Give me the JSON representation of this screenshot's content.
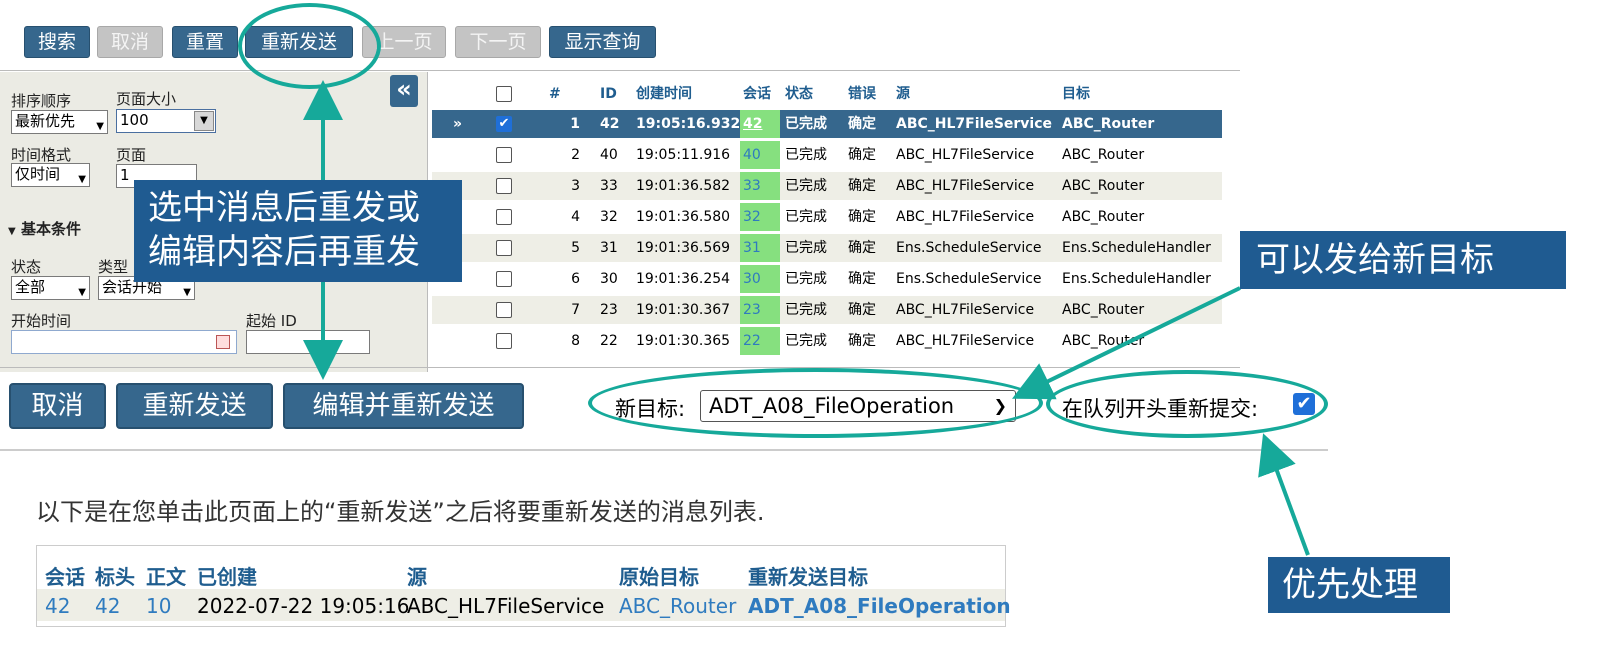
{
  "toolbar": {
    "search": "搜索",
    "cancel": "取消",
    "reset": "重置",
    "resend": "重新发送",
    "prev": "上一页",
    "next": "下一页",
    "show_query": "显示查询"
  },
  "filter": {
    "sort_label": "排序顺序",
    "sort_value": "最新优先",
    "pagesize_label": "页面大小",
    "pagesize_value": "100",
    "timeformat_label": "时间格式",
    "timeformat_value": "仅时间",
    "page_label": "页面",
    "page_value": "1",
    "section_title": "基本条件",
    "status_label": "状态",
    "status_value": "全部",
    "type_label": "类型",
    "type_value": "会话开始",
    "start_time_label": "开始时间",
    "start_id_label": "起始 ID",
    "collapse_glyph": "«"
  },
  "table": {
    "headers": {
      "num": "#",
      "id": "ID",
      "time": "创建时间",
      "session": "会话",
      "status": "状态",
      "error": "错误",
      "source": "源",
      "target": "目标"
    },
    "selected_marker": "»",
    "rows": [
      {
        "num": "1",
        "id": "42",
        "time": "19:05:16.932",
        "session": "42",
        "status": "已完成",
        "error": "确定",
        "source": "ABC_HL7FileService",
        "target": "ABC_Router"
      },
      {
        "num": "2",
        "id": "40",
        "time": "19:05:11.916",
        "session": "40",
        "status": "已完成",
        "error": "确定",
        "source": "ABC_HL7FileService",
        "target": "ABC_Router"
      },
      {
        "num": "3",
        "id": "33",
        "time": "19:01:36.582",
        "session": "33",
        "status": "已完成",
        "error": "确定",
        "source": "ABC_HL7FileService",
        "target": "ABC_Router"
      },
      {
        "num": "4",
        "id": "32",
        "time": "19:01:36.580",
        "session": "32",
        "status": "已完成",
        "error": "确定",
        "source": "ABC_HL7FileService",
        "target": "ABC_Router"
      },
      {
        "num": "5",
        "id": "31",
        "time": "19:01:36.569",
        "session": "31",
        "status": "已完成",
        "error": "确定",
        "source": "Ens.ScheduleService",
        "target": "Ens.ScheduleHandler"
      },
      {
        "num": "6",
        "id": "30",
        "time": "19:01:36.254",
        "session": "30",
        "status": "已完成",
        "error": "确定",
        "source": "Ens.ScheduleService",
        "target": "Ens.ScheduleHandler"
      },
      {
        "num": "7",
        "id": "23",
        "time": "19:01:30.367",
        "session": "23",
        "status": "已完成",
        "error": "确定",
        "source": "ABC_HL7FileService",
        "target": "ABC_Router"
      },
      {
        "num": "8",
        "id": "22",
        "time": "19:01:30.365",
        "session": "22",
        "status": "已完成",
        "error": "确定",
        "source": "ABC_HL7FileService",
        "target": "ABC_Router"
      }
    ]
  },
  "actions": {
    "cancel": "取消",
    "resend": "重新发送",
    "edit_resend": "编辑并重新发送",
    "new_target_label": "新目标:",
    "new_target_value": "ADT_A08_FileOperation",
    "head_of_queue_label": "在队列开头重新提交:"
  },
  "callouts": {
    "resend_line1": "选中消息后重发或",
    "resend_line2": "编辑内容后再重发",
    "new_target": "可以发给新目标",
    "priority": "优先处理"
  },
  "list": {
    "intro": "以下是在您单击此页面上的“重新发送”之后将要重新发送的消息列表.",
    "headers": {
      "session": "会话",
      "header": "标头",
      "body": "正文",
      "created": "已创建",
      "source": "源",
      "orig_target": "原始目标",
      "resend_target": "重新发送目标"
    },
    "row": {
      "session": "42",
      "header": "42",
      "body": "10",
      "created": "2022-07-22 19:05:16",
      "source": "ABC_HL7FileService",
      "orig_target": "ABC_Router",
      "resend_target": "ADT_A08_FileOperation"
    }
  },
  "colors": {
    "primary": "#36678d",
    "callout": "#1f5b91",
    "annotation": "#16a99a",
    "selected_row": "#36678d",
    "session_cell": "#86e07f"
  }
}
